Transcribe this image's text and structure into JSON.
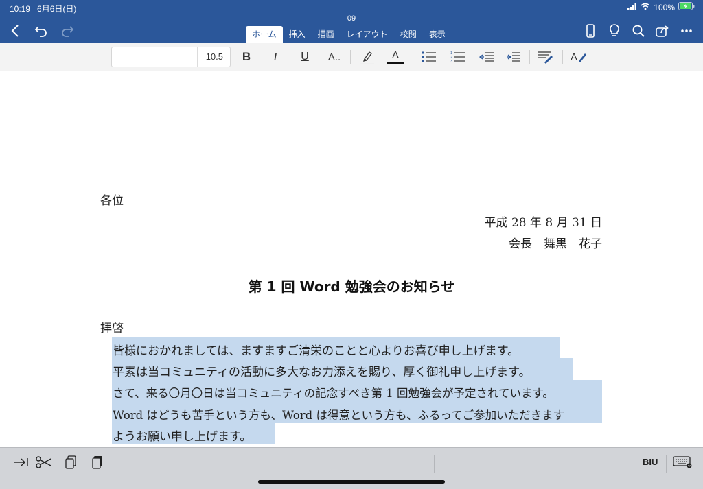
{
  "status": {
    "time": "10:19",
    "date": "6月6日(日)",
    "battery": "100%"
  },
  "title": "09",
  "tabs": [
    {
      "label": "ホーム",
      "active": true
    },
    {
      "label": "挿入"
    },
    {
      "label": "描画"
    },
    {
      "label": "レイアウト"
    },
    {
      "label": "校閲"
    },
    {
      "label": "表示"
    }
  ],
  "ribbon": {
    "font_name": "",
    "font_size": "10.5",
    "bold": "B",
    "italic": "I",
    "underline": "U",
    "text_effects": "A..",
    "font_color_letter": "A",
    "styles_letter": "A"
  },
  "document": {
    "recipient": "各位",
    "date_line": "平成 28 年 8 月 31 日",
    "sender": "会長　舞黒　花子",
    "heading": "第 1 回 Word 勉強会のお知らせ",
    "salutation": "拝啓",
    "body_lines": [
      "皆様におかれましては、ますますご清栄のことと心よりお喜び申し上げます。",
      "平素は当コミュニティの活動に多大なお力添えを賜り、厚く御礼申し上げます。",
      "さて、来る〇月〇日は当コミュニティの記念すべき第 1 回勉強会が予定されています。",
      "Word はどうも苦手という方も、Word は得意という方も、ふるってご参加いただきます",
      "ようお願い申し上げます。"
    ]
  },
  "bottom": {
    "biu": "BIU"
  },
  "colors": {
    "header": "#2b579a",
    "selection": "#c5d9ee",
    "ribbon": "#f3f3f3"
  }
}
